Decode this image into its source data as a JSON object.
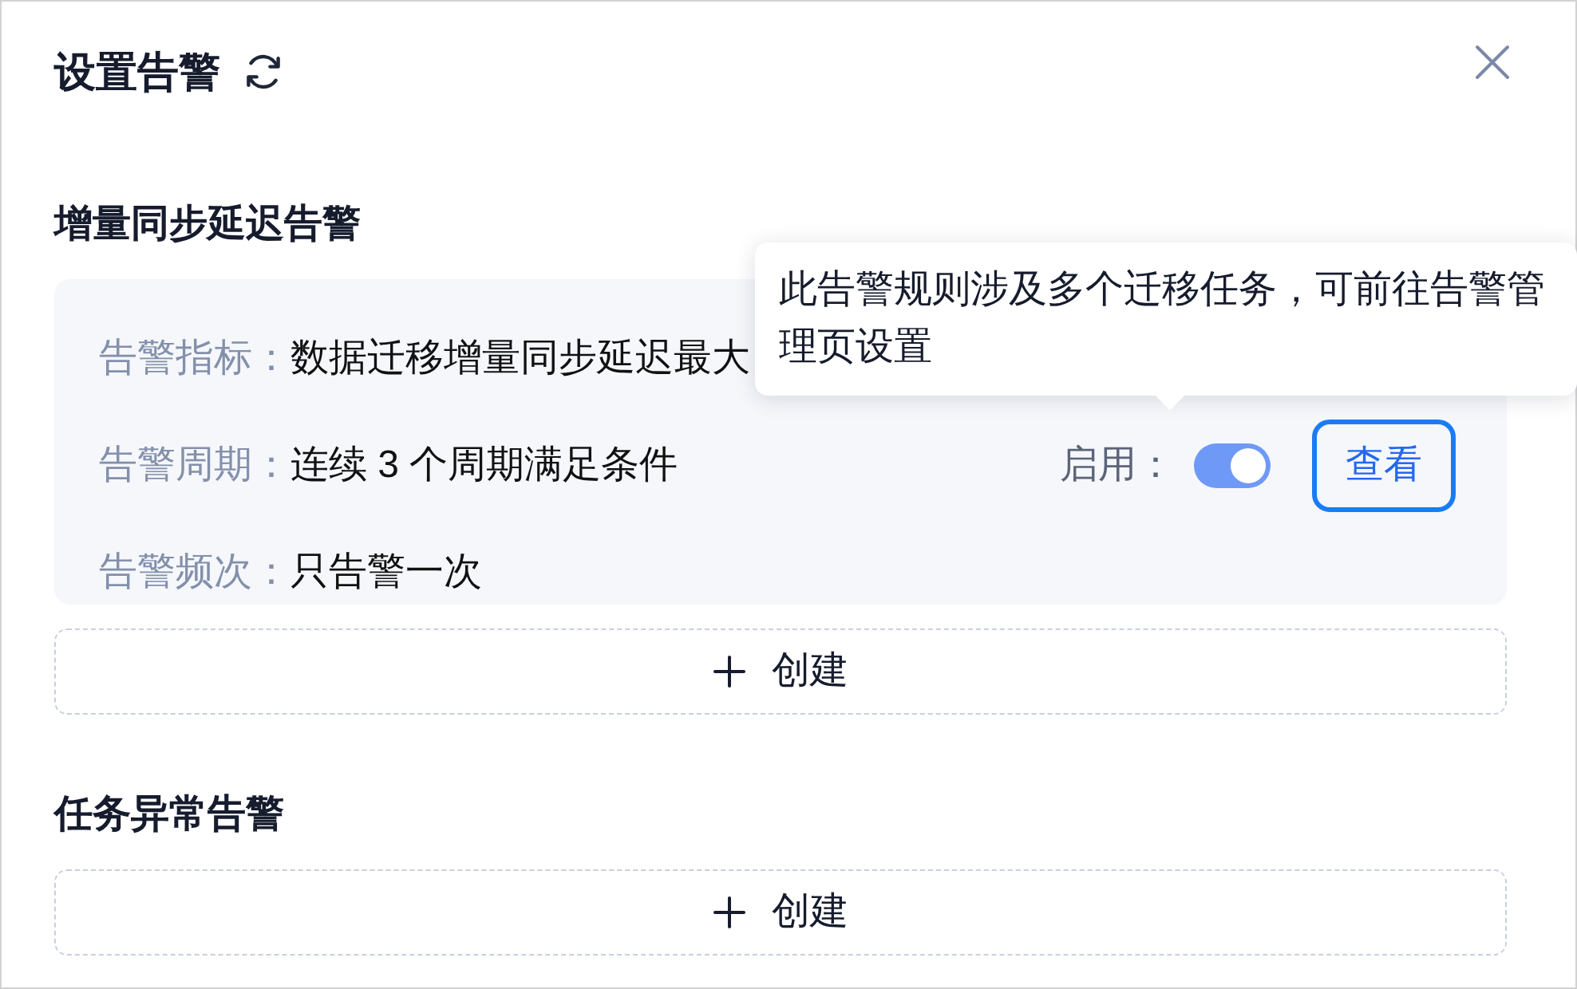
{
  "dialog": {
    "title": "设置告警"
  },
  "sections": [
    {
      "title": "增量同步延迟告警",
      "rules": [
        {
          "fields": [
            {
              "label": "告警指标：",
              "value": "数据迁移增量同步延迟最大"
            },
            {
              "label": "告警周期：",
              "value": "连续 3 个周期满足条件"
            },
            {
              "label": "告警频次：",
              "value": "只告警一次"
            }
          ],
          "switch": {
            "label": "启用：",
            "on": true
          },
          "view_button": {
            "label": "查看",
            "focused": true
          }
        }
      ],
      "create_button": "创建"
    },
    {
      "title": "任务异常告警",
      "create_button": "创建"
    }
  ],
  "tooltip": {
    "text": "此告警规则涉及多个迁移任务，可前往告警管理页设置"
  }
}
